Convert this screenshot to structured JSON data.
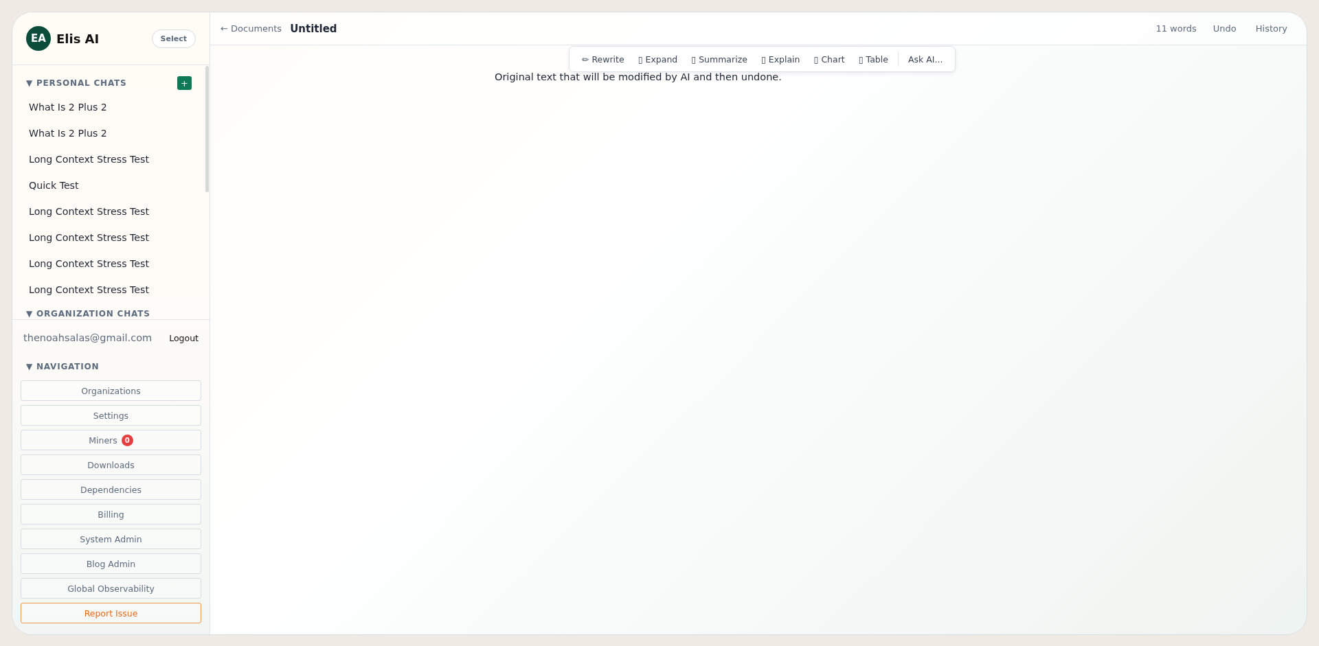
{
  "sidebar": {
    "avatar": "EA",
    "brand": "Elis AI",
    "select_button": "Select",
    "sections": [
      {
        "title": "PERSONAL CHATS",
        "arrow": "▼",
        "add": "+",
        "items": [
          {
            "label": "What Is 2 Plus 2"
          },
          {
            "label": "What Is 2 Plus 2"
          },
          {
            "label": "Long Context Stress Test"
          },
          {
            "label": "Quick Test"
          },
          {
            "label": "Long Context Stress Test"
          },
          {
            "label": "Long Context Stress Test"
          },
          {
            "label": "Long Context Stress Test"
          },
          {
            "label": "Long Context Stress Test"
          }
        ]
      },
      {
        "title": "ORGANIZATION CHATS",
        "arrow": "▼"
      }
    ],
    "email": "thenoahsalas@gmail.com",
    "logout": "Logout",
    "navigation": {
      "title": "NAVIGATION",
      "arrow": "▼",
      "items": [
        {
          "label": "Organizations",
          "kind": "plain"
        },
        {
          "label": "Settings",
          "kind": "plain"
        },
        {
          "label": "Miners",
          "kind": "plain",
          "badge": "0"
        },
        {
          "label": "Downloads",
          "kind": "plain"
        },
        {
          "label": "Dependencies",
          "kind": "plain"
        },
        {
          "label": "Billing",
          "kind": "plain"
        },
        {
          "label": "System Admin",
          "kind": "plain"
        },
        {
          "label": "Blog Admin",
          "kind": "plain"
        },
        {
          "label": "Global Observability",
          "kind": "plain"
        },
        {
          "label": "Report Issue",
          "kind": "warning"
        }
      ]
    }
  },
  "top_bar": {
    "back": "← Documents",
    "title": "Untitled",
    "word_count": "11 words",
    "undo": "Undo",
    "history": "History"
  },
  "ai_toolbar": {
    "actions": [
      {
        "icon": "✏",
        "label": "Rewrite"
      },
      {
        "icon": "▯",
        "label": "Expand"
      },
      {
        "icon": "▯",
        "label": "Summarize"
      },
      {
        "icon": "▯",
        "label": "Explain"
      },
      {
        "icon": "▯",
        "label": "Chart"
      },
      {
        "icon": "▯",
        "label": "Table"
      }
    ],
    "ask": "Ask AI..."
  },
  "document": {
    "text": "Original text that will be modified by AI and then undone."
  }
}
